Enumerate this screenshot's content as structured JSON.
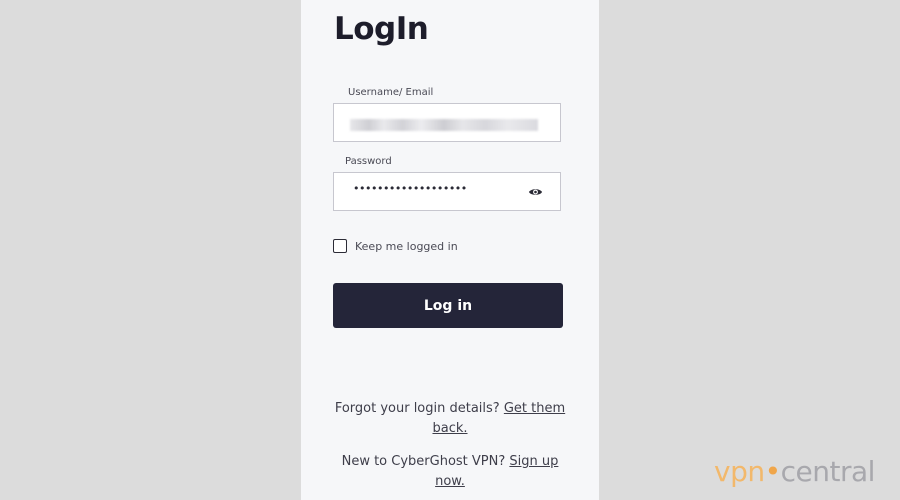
{
  "form": {
    "title": "LogIn",
    "username_label": "Username/ Email",
    "password_label": "Password",
    "password_mask": "•••••••••••••••••••",
    "remember_label": "Keep me logged in",
    "login_button": "Log in"
  },
  "footer": {
    "forgot_text": "Forgot your login details?",
    "forgot_link": "Get them back.",
    "new_text": "New to CyberGhost VPN?",
    "signup_link": "Sign up now."
  },
  "watermark": {
    "brand_left": "vpn",
    "brand_right": "central"
  },
  "colors": {
    "button": "#242539",
    "panel": "#f6f7f9",
    "background": "#dcdcdc"
  }
}
